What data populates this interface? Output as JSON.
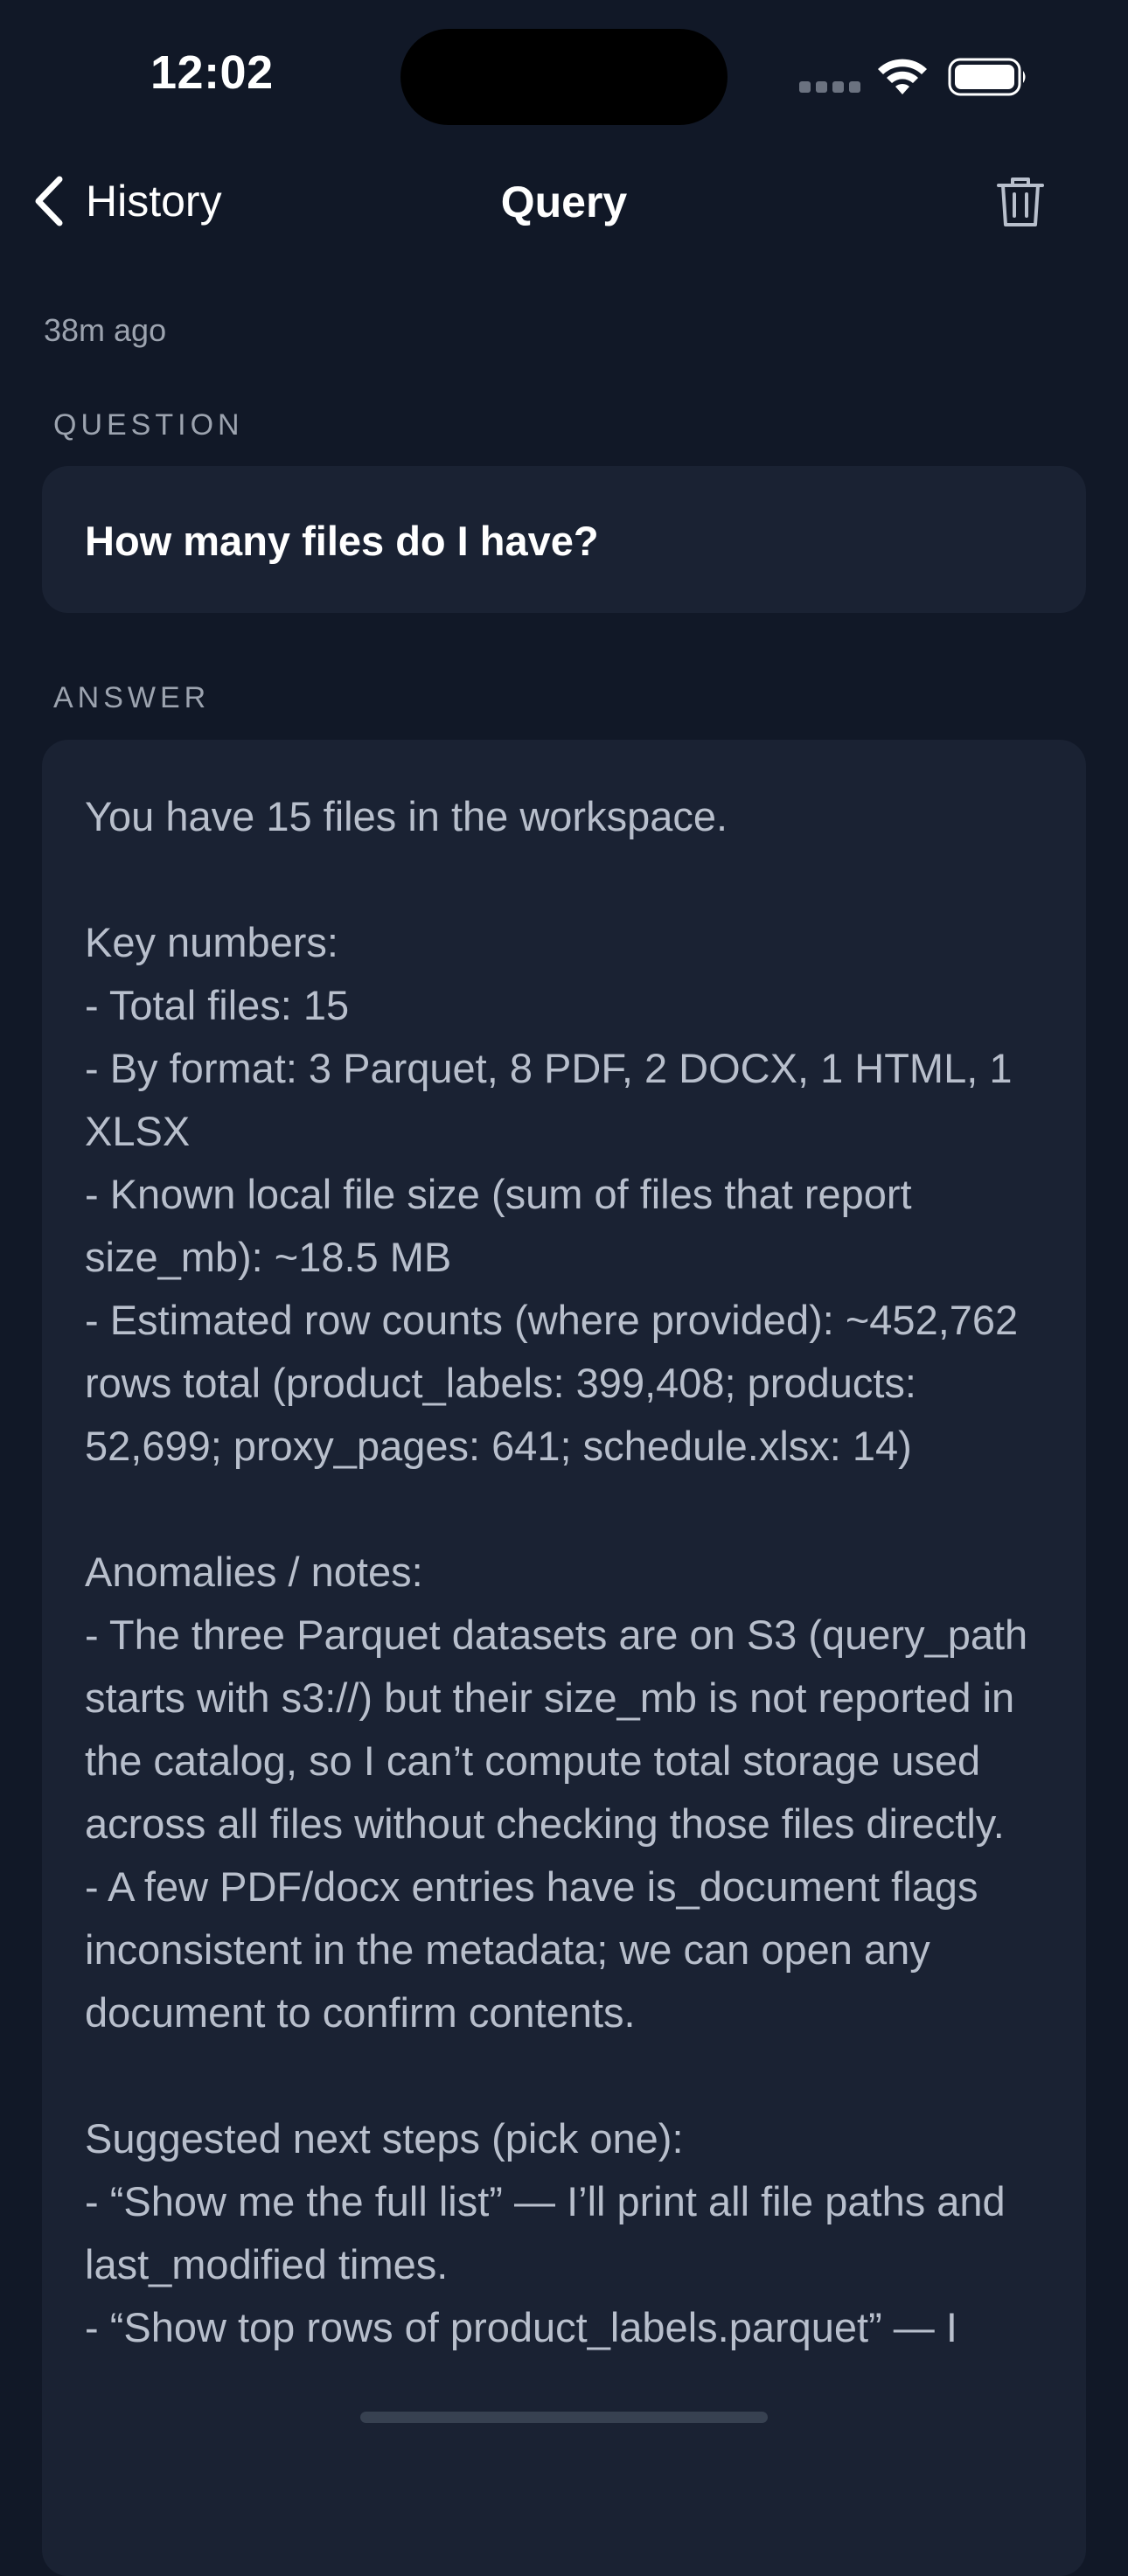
{
  "status_bar": {
    "time": "12:02"
  },
  "nav": {
    "back_label": "History",
    "title": "Query"
  },
  "query": {
    "timestamp": "38m ago",
    "question_label": "QUESTION",
    "question": "How many files do I have?",
    "answer_label": "ANSWER",
    "answer": "You have 15 files in the workspace.\n\nKey numbers:\n- Total files: 15\n- By format: 3 Parquet, 8 PDF, 2 DOCX, 1 HTML, 1 XLSX\n- Known local file size (sum of files that report size_mb): ~18.5 MB\n- Estimated row counts (where provided): ~452,762 rows total (product_labels: 399,408; products: 52,699; proxy_pages: 641; schedule.xlsx: 14)\n\nAnomalies / notes:\n- The three Parquet datasets are on S3 (query_path starts with s3://) but their size_mb is not reported in the catalog, so I can’t compute total storage used across all files without checking those files directly.\n- A few PDF/docx entries have is_document flags inconsistent in the metadata; we can open any document to confirm contents.\n\nSuggested next steps (pick one):\n- “Show me the full list” — I’ll print all file paths and last_modified times.\n- “Show top rows of product_labels.parquet” — I"
  },
  "icons": {
    "back": "chevron-left-icon",
    "trash": "trash-icon",
    "wifi": "wifi-icon",
    "battery": "battery-icon",
    "signal": "cellular-signal-icon"
  },
  "colors": {
    "background": "#111827",
    "card": "#1a2233",
    "muted_text": "#9ca3af",
    "answer_text": "#b8bfcc"
  }
}
